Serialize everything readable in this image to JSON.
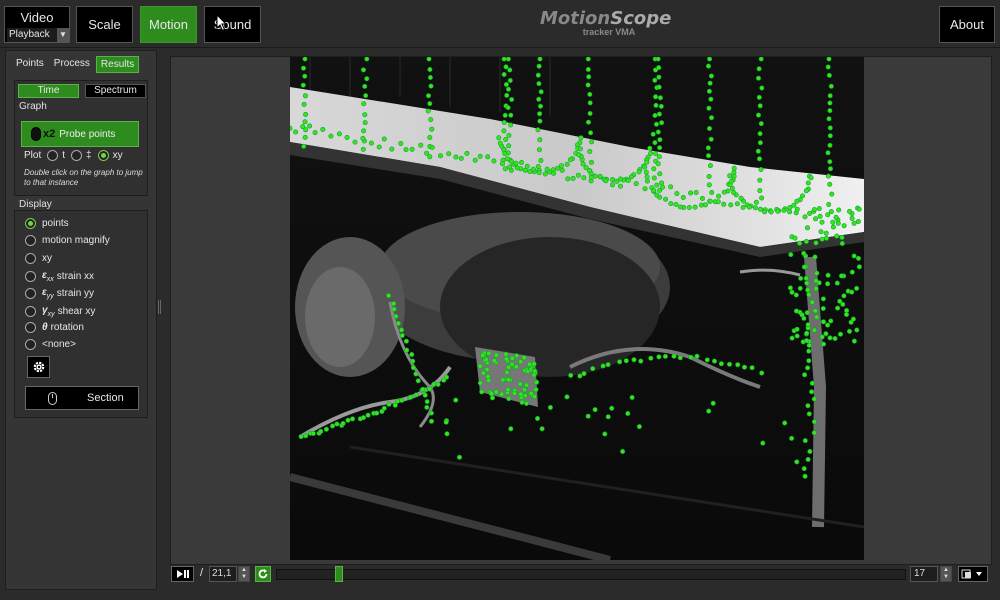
{
  "topbar": {
    "video_label": "Video",
    "mode_select": "Playback",
    "buttons": [
      "Scale",
      "Motion",
      "Sound"
    ],
    "active_button": "Motion",
    "about_label": "About",
    "logo_main_a": "Motion",
    "logo_main_b": "Scope",
    "logo_sub": "tracker VMA"
  },
  "left_panel": {
    "tabs": [
      "Points",
      "Process",
      "Results"
    ],
    "active_tab": "Results",
    "view_buttons": [
      "Time",
      "Spectrum"
    ],
    "active_view": "Time",
    "graph_header": "Graph",
    "probe_multiplier": "x2",
    "probe_label": "Probe points",
    "plot_label": "Plot",
    "plot_options": [
      "t",
      "‡",
      "xy"
    ],
    "plot_selected": "xy",
    "hint": "Double click on the graph to jump to that instance",
    "display_header": "Display",
    "display_options": [
      {
        "sym": "",
        "sub": "",
        "label": "points",
        "selected": true
      },
      {
        "sym": "",
        "sub": "",
        "label": "motion magnify",
        "selected": false
      },
      {
        "sym": "",
        "sub": "",
        "label": "xy",
        "selected": false
      },
      {
        "sym": "ε",
        "sub": "xx",
        "label": "strain xx",
        "selected": false
      },
      {
        "sym": "ε",
        "sub": "yy",
        "label": "strain yy",
        "selected": false
      },
      {
        "sym": "γ",
        "sub": "xy",
        "label": "shear xy",
        "selected": false
      },
      {
        "sym": "θ",
        "sub": "",
        "label": "rotation",
        "selected": false
      },
      {
        "sym": "",
        "sub": "",
        "label": "<none>",
        "selected": false
      }
    ],
    "section_button": "Section"
  },
  "playback": {
    "slash": "/",
    "frame_value": "21,1",
    "fps_value": "17",
    "progress": 0.1
  },
  "colors": {
    "accent": "#2e8b1e",
    "tracking_point": "#3ee01e"
  },
  "icons": [
    "play-pause-icon",
    "loop-icon",
    "gear-icon",
    "mouse-icon",
    "view-layout-icon",
    "chevron-down-icon",
    "cursor-icon"
  ]
}
